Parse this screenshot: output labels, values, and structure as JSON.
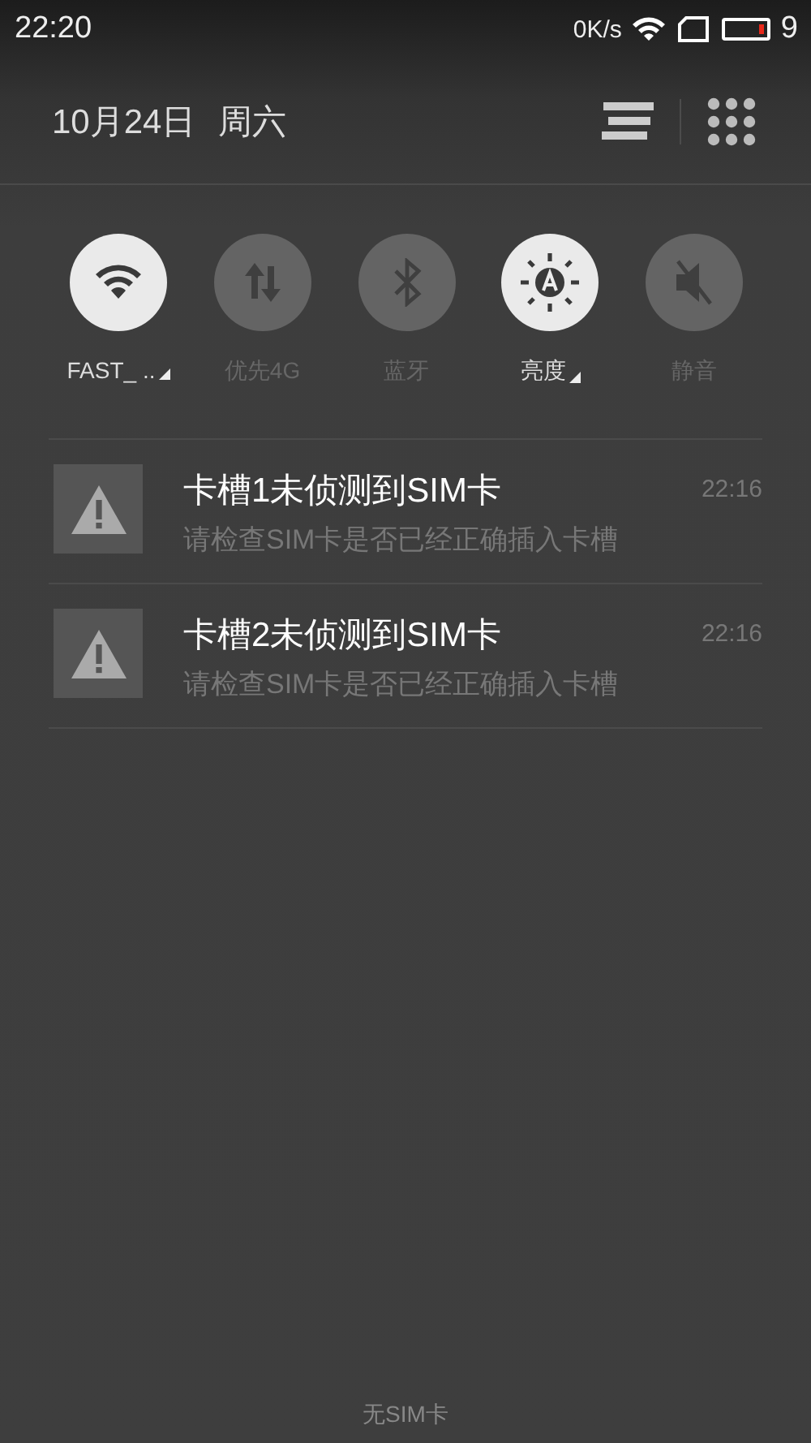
{
  "status_bar": {
    "time": "22:20",
    "net_speed": "0K/s",
    "battery": "9"
  },
  "header": {
    "date": "10月24日",
    "weekday": "周六"
  },
  "toggles": [
    {
      "kind": "wifi",
      "label": "FAST_ ..",
      "on": true,
      "has_menu": true
    },
    {
      "kind": "data",
      "label": "优先4G",
      "on": false,
      "has_menu": false
    },
    {
      "kind": "bluetooth",
      "label": "蓝牙",
      "on": false,
      "has_menu": false
    },
    {
      "kind": "brightness",
      "label": "亮度",
      "on": true,
      "has_menu": true
    },
    {
      "kind": "mute",
      "label": "静音",
      "on": false,
      "has_menu": false
    }
  ],
  "notifications": [
    {
      "title": "卡槽1未侦测到SIM卡",
      "text": "请检查SIM卡是否已经正确插入卡槽",
      "time": "22:16"
    },
    {
      "title": "卡槽2未侦测到SIM卡",
      "text": "请检查SIM卡是否已经正确插入卡槽",
      "time": "22:16"
    }
  ],
  "footer": {
    "carrier": "无SIM卡"
  }
}
